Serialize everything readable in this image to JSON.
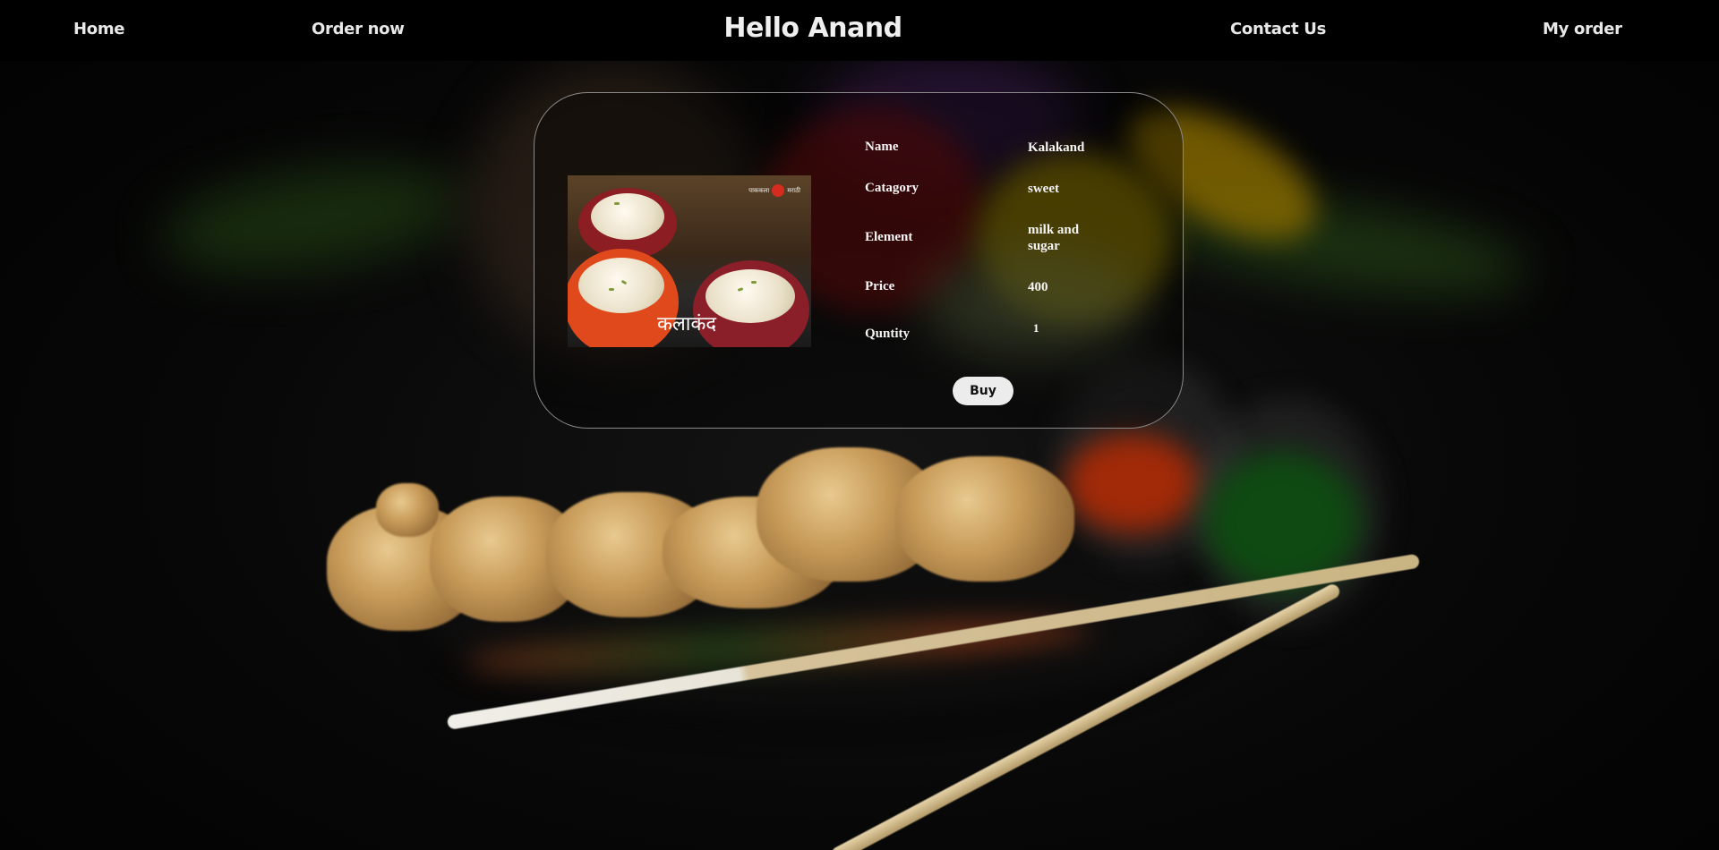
{
  "nav": {
    "home": "Home",
    "order_now": "Order now",
    "greeting": "Hello Anand",
    "contact": "Contact Us",
    "my_order": "My order"
  },
  "product": {
    "image_logo_text": "पाककला",
    "image_logo_text_2": "मराठी",
    "image_caption": "कलाकंद",
    "fields": {
      "name": {
        "label": "Name",
        "value": "Kalakand"
      },
      "category": {
        "label": "Catagory",
        "value": "sweet"
      },
      "element": {
        "label": "Element",
        "value": "milk and sugar"
      },
      "price": {
        "label": "Price",
        "value": "400"
      },
      "quantity": {
        "label": "Quntity",
        "value": "1"
      }
    },
    "buy_label": "Buy"
  }
}
